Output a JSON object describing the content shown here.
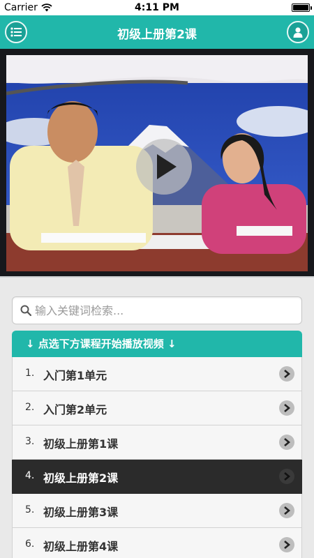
{
  "status_bar": {
    "carrier": "Carrier",
    "time": "4:11 PM"
  },
  "nav": {
    "title": "初级上册第2课",
    "menu_icon": "list-icon",
    "user_icon": "user-icon"
  },
  "video": {
    "play_icon": "play-icon",
    "state": "paused"
  },
  "search": {
    "placeholder": "输入关键词检索...",
    "value": ""
  },
  "list": {
    "header": "↓ 点选下方课程开始播放视频 ↓",
    "items": [
      {
        "num": "1.",
        "title": "入门第1单元",
        "active": false
      },
      {
        "num": "2.",
        "title": "入门第2单元",
        "active": false
      },
      {
        "num": "3.",
        "title": "初级上册第1课",
        "active": false
      },
      {
        "num": "4.",
        "title": "初级上册第2课",
        "active": true
      },
      {
        "num": "5.",
        "title": "初级上册第3课",
        "active": false
      },
      {
        "num": "6.",
        "title": "初级上册第4课",
        "active": false
      }
    ]
  },
  "colors": {
    "accent": "#21b7aa",
    "active_row": "#2b2b2b",
    "row_bg": "#f6f6f6"
  }
}
